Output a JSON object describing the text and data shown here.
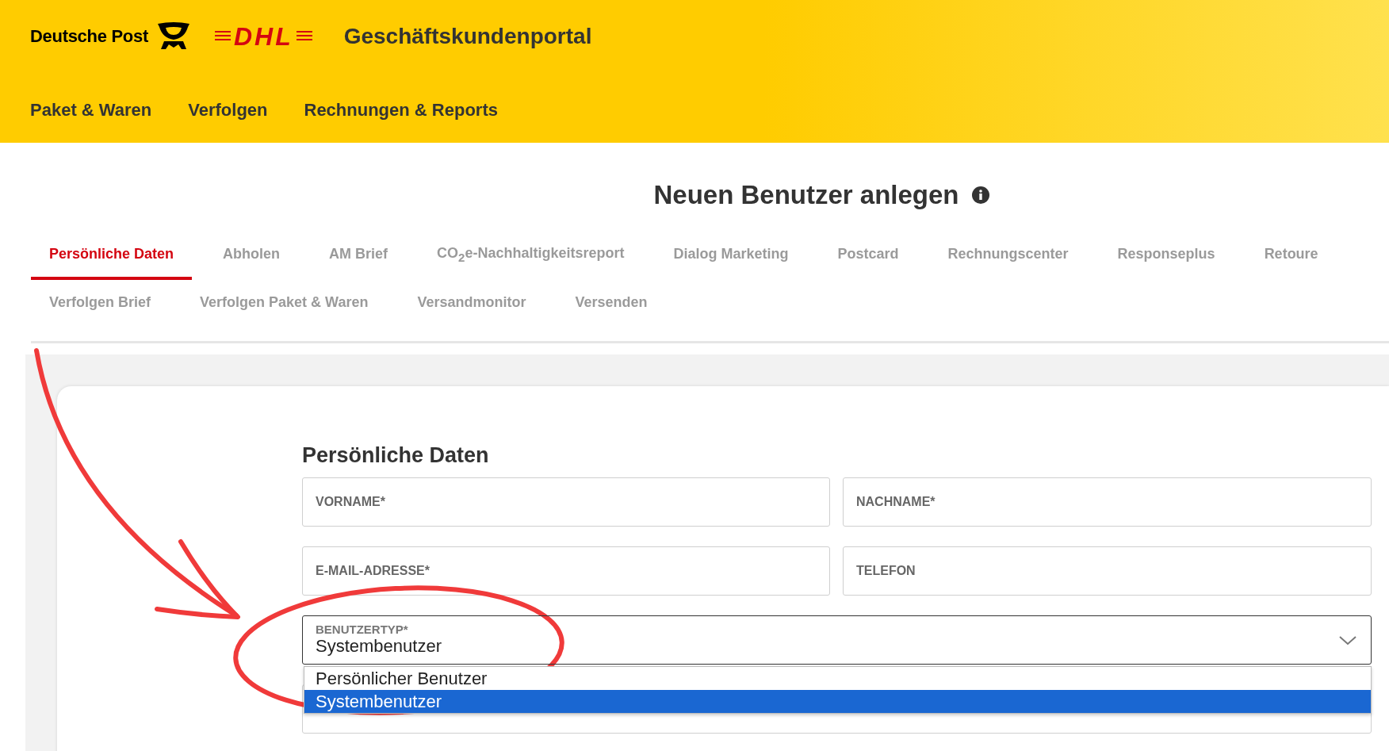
{
  "header": {
    "brand": "Deutsche Post",
    "logo_text": "DHL",
    "portal_title": "Geschäftskundenportal",
    "nav": [
      "Paket & Waren",
      "Verfolgen",
      "Rechnungen & Reports"
    ]
  },
  "page_title": "Neuen Benutzer anlegen",
  "tabs": [
    {
      "label": "Persönliche Daten",
      "selected": true
    },
    {
      "label": "Abholen",
      "selected": false
    },
    {
      "label": "AM Brief",
      "selected": false
    },
    {
      "label": "CO$_{2}$e-Nachhaltigkeitsreport",
      "selected": false
    },
    {
      "label": "Dialog Marketing",
      "selected": false
    },
    {
      "label": "Postcard",
      "selected": false
    },
    {
      "label": "Rechnungscenter",
      "selected": false
    },
    {
      "label": "Responseplus",
      "selected": false
    },
    {
      "label": "Retoure",
      "selected": false
    },
    {
      "label": "Verfolgen Brief",
      "selected": false
    },
    {
      "label": "Verfolgen Paket & Waren",
      "selected": false
    },
    {
      "label": "Versandmonitor",
      "selected": false
    },
    {
      "label": "Versenden",
      "selected": false
    }
  ],
  "form": {
    "heading": "Persönliche Daten",
    "fields": [
      {
        "kind": "text",
        "label": "VORNAME*"
      },
      {
        "kind": "text",
        "label": "NACHNAME*"
      },
      {
        "kind": "text",
        "label": "E-MAIL-ADRESSE*"
      },
      {
        "kind": "text",
        "label": "TELEFON"
      },
      {
        "kind": "select",
        "label": "BENUTZERTYP*",
        "value": "Systembenutzer",
        "expanded": true,
        "options": [
          {
            "label": "Persönlicher Benutzer",
            "selected": false
          },
          {
            "label": "Systembenutzer",
            "selected": true
          }
        ]
      },
      {
        "kind": "hidden"
      }
    ]
  }
}
